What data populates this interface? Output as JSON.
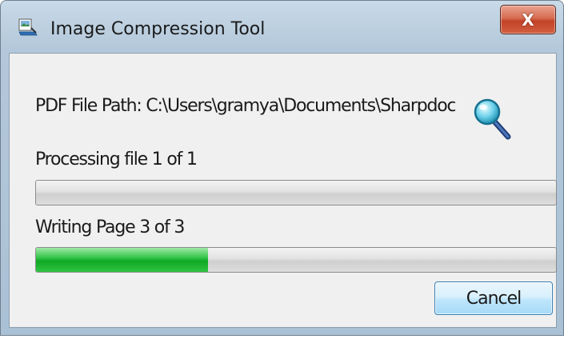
{
  "window": {
    "title": "Image Compression Tool",
    "close_label": "X"
  },
  "form": {
    "pdf_path_text": "PDF File Path: C:\\Users\\gramya\\Documents\\Sharpdocs",
    "browse_icon": "magnifier-icon"
  },
  "progress": {
    "file_status": "Processing file 1 of 1",
    "file_fraction": 0.0,
    "page_status": "Writing Page 3 of 3",
    "page_fraction": 0.33
  },
  "buttons": {
    "cancel_label": "Cancel"
  },
  "colors": {
    "progress_fill": "#1db331",
    "close_button": "#c9492e",
    "cancel_button": "#bee6fd"
  }
}
